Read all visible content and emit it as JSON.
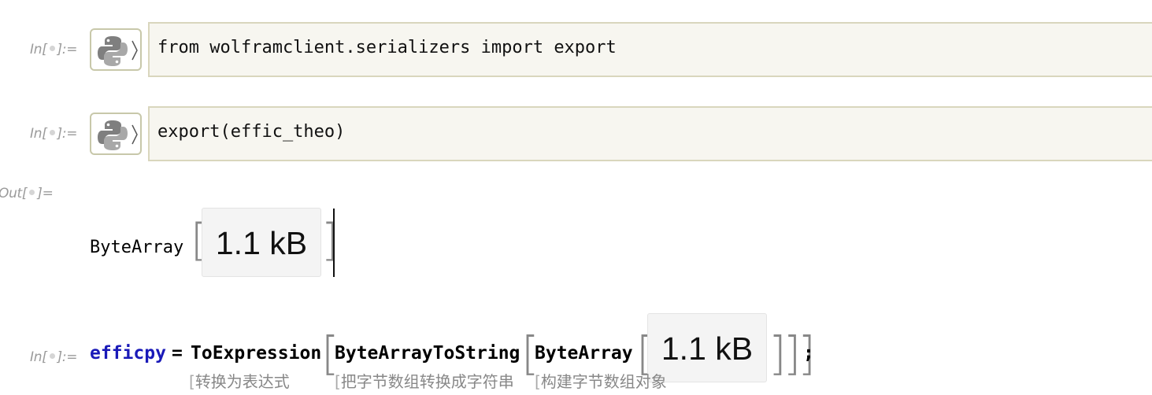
{
  "cells": {
    "in1": {
      "label_prefix": "In[",
      "label_suffix": "]:=",
      "code": "from wolframclient.serializers import export"
    },
    "in2": {
      "label_prefix": "In[",
      "label_suffix": "]:=",
      "code": "export(effic_theo)"
    },
    "out1": {
      "label_prefix": "Out[",
      "label_suffix": "]=",
      "head": "ByteArray",
      "size_label": "1.1 kB"
    },
    "in3": {
      "label_prefix": "In[",
      "label_suffix": "]:=",
      "variable": "efficpy",
      "equals": "=",
      "func1": "ToExpression",
      "func2": "ByteArrayToString",
      "func3": "ByteArray",
      "size_label": "1.1 kB",
      "closing": "]]]",
      "semicolon": ";",
      "annotation1": "转换为表达式",
      "annotation2": "把字节数组转换成字符串",
      "annotation3": "构建字节数组对象"
    }
  },
  "colors": {
    "variable": "#1a1ab8",
    "label": "#9a9a9a",
    "code_bg": "#f7f6f0",
    "code_border": "#d9d6bd"
  },
  "icons": {
    "python_button": "python-logo-icon",
    "chevron": "chevron-right-icon"
  }
}
